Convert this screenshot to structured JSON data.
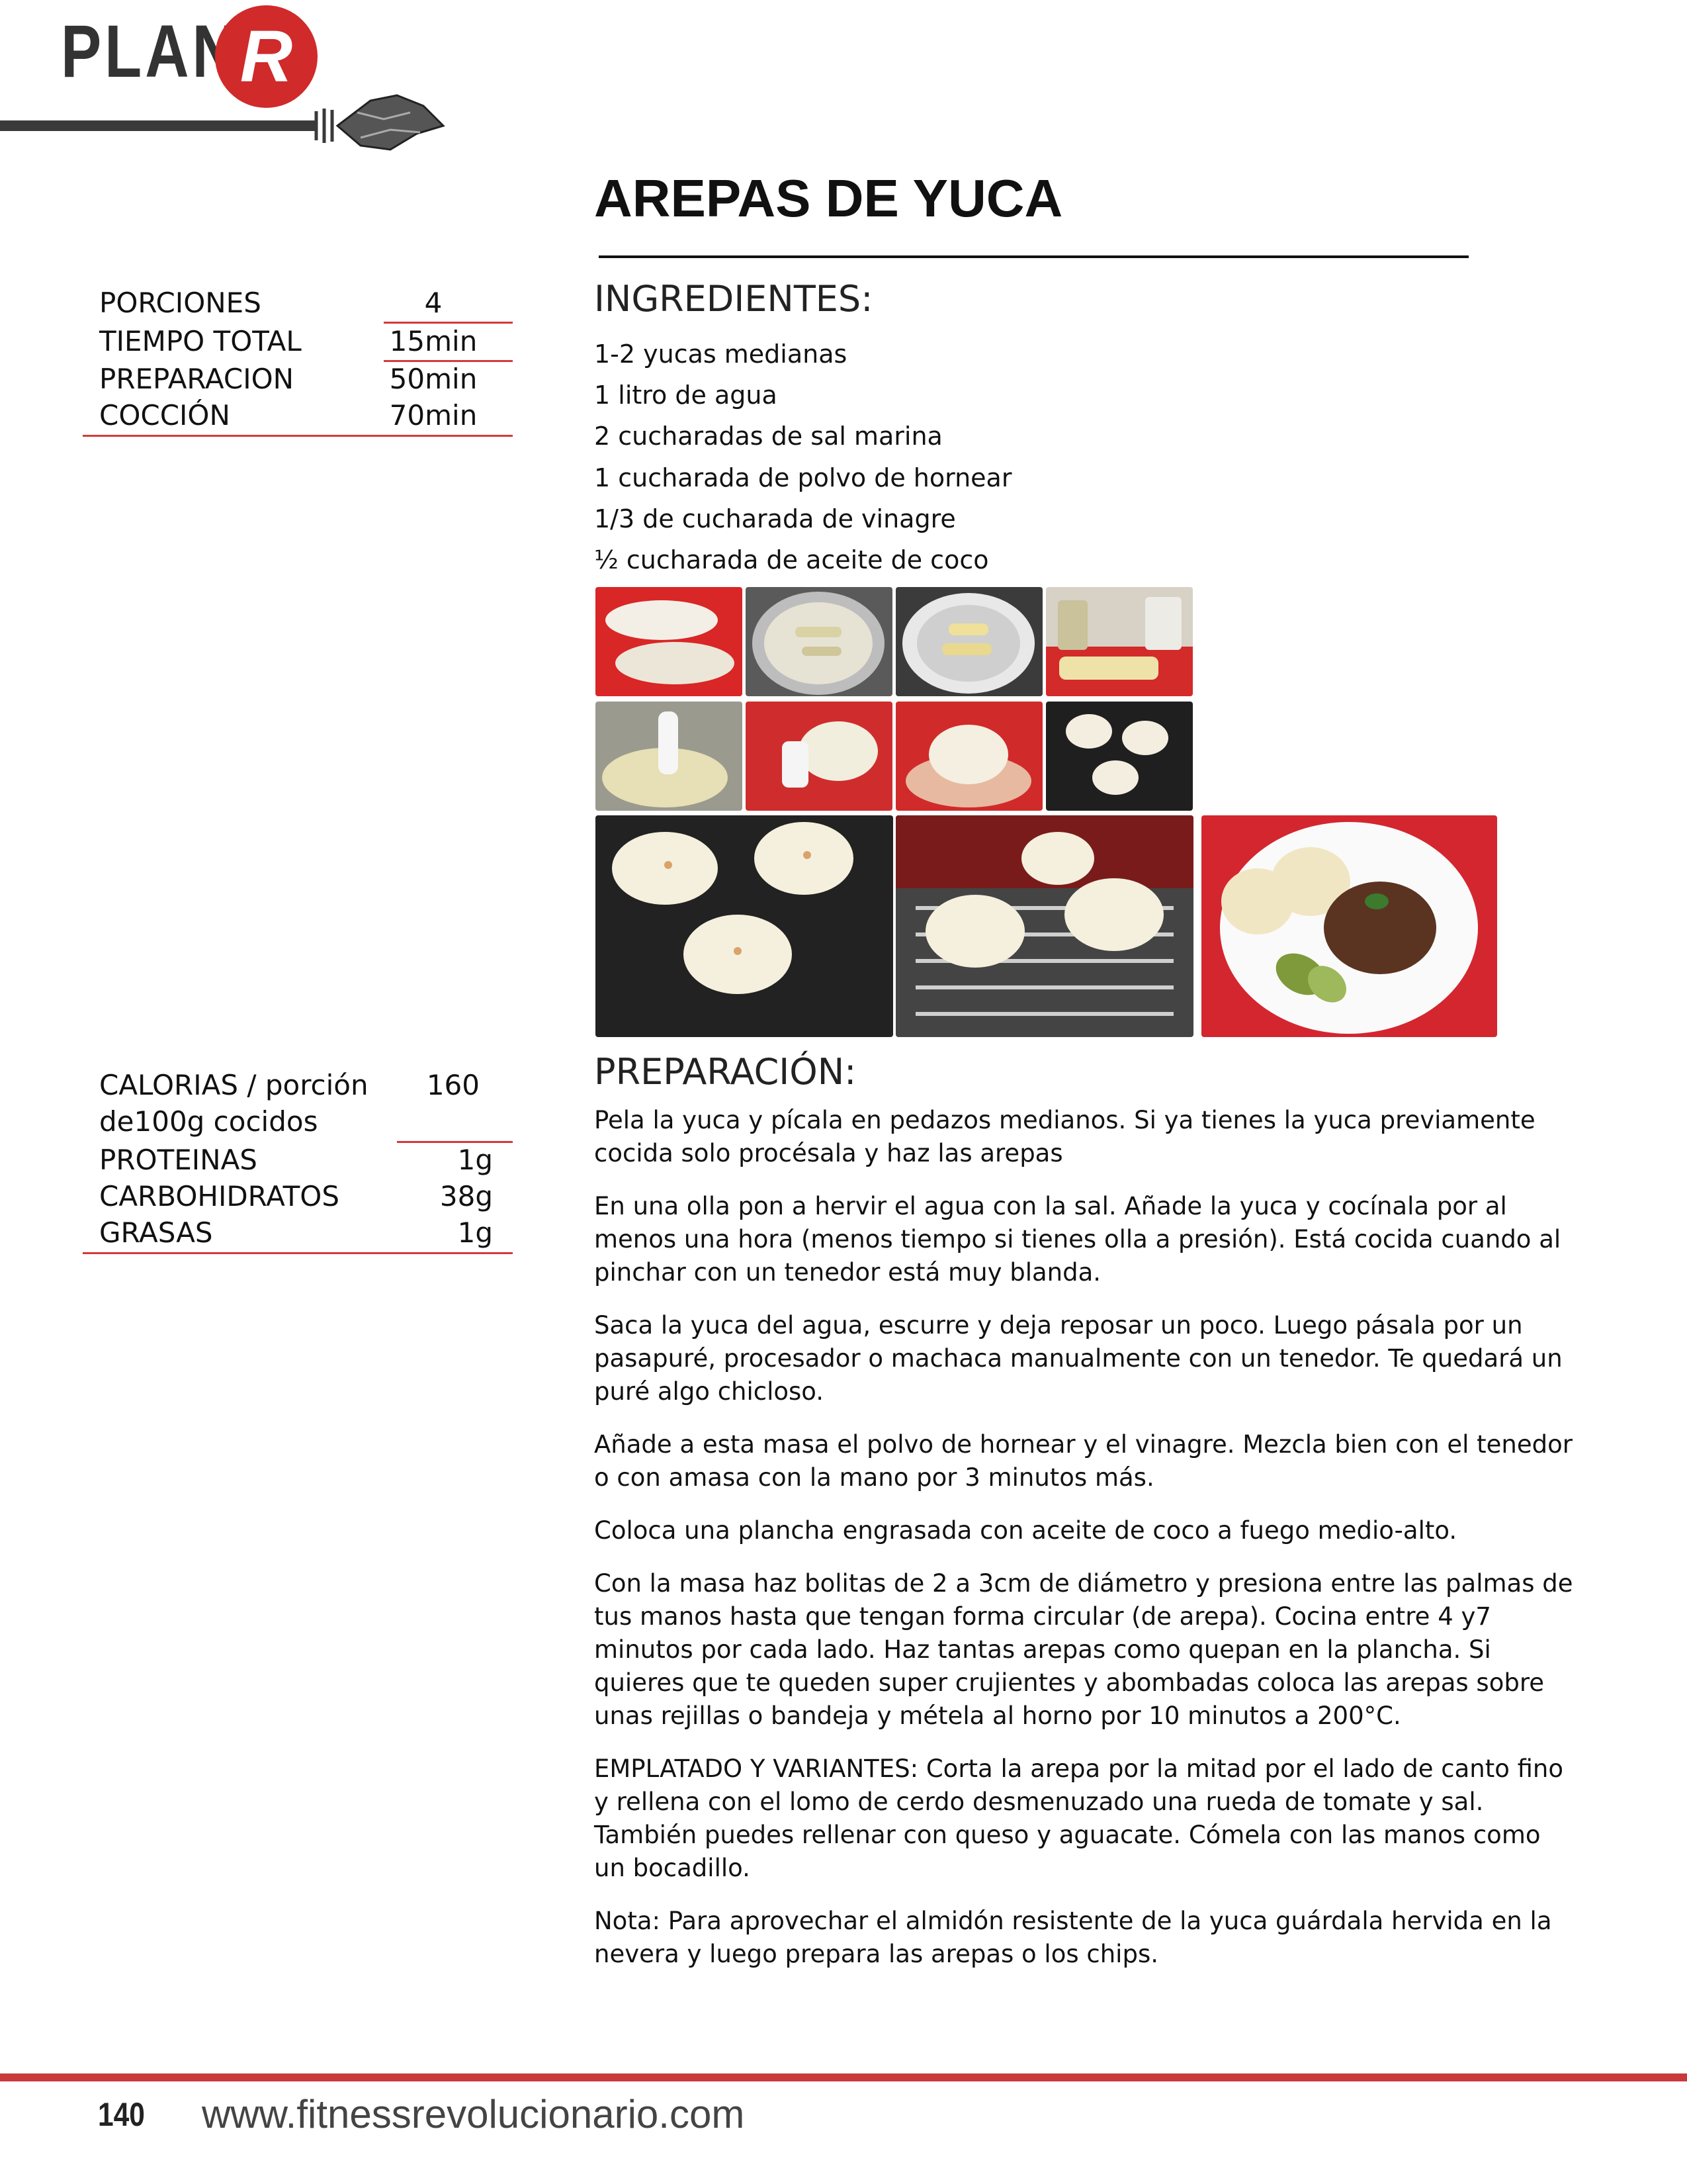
{
  "header": {
    "logo_text": "PLAN",
    "logo_letter": "R"
  },
  "title": "AREPAS DE YUCA",
  "info_table": [
    {
      "label": "PORCIONES",
      "value": "4"
    },
    {
      "label": "TIEMPO TOTAL",
      "value": "15min"
    },
    {
      "label": "PREPARACION",
      "value": "50min"
    },
    {
      "label": "COCCIÓN",
      "value": "70min"
    }
  ],
  "nutrition": {
    "calories_label": "CALORIAS / porción",
    "calories_sub": "de100g cocidos",
    "calories_value": "160",
    "rows": [
      {
        "label": "PROTEINAS",
        "value": "1g"
      },
      {
        "label": "CARBOHIDRATOS",
        "value": "38g"
      },
      {
        "label": "GRASAS",
        "value": "1g"
      }
    ]
  },
  "ingredients_heading": "INGREDIENTES:",
  "ingredients": [
    "1-2 yucas medianas",
    "1 litro de agua",
    "2 cucharadas de sal marina",
    "1 cucharada de polvo de hornear",
    "1/3 de cucharada de vinagre",
    "½ cucharada de aceite de coco"
  ],
  "preparation_heading": "PREPARACIÓN:",
  "preparation": [
    "Pela la yuca y pícala en pedazos medianos. Si ya tienes la yuca previamente cocida solo procésala y haz las arepas",
    "En una olla pon a hervir el agua con la sal. Añade la yuca y cocínala por al menos una hora (menos tiempo si tienes olla a presión). Está cocida cuando al pinchar con un tenedor está muy blanda.",
    "Saca la yuca del agua, escurre y deja reposar un poco. Luego pásala por un pasapuré, procesador o machaca manualmente con un tenedor. Te quedará un puré algo chicloso.",
    "Añade a esta masa el polvo de hornear y el vinagre. Mezcla bien con el tenedor o con amasa con la mano por 3 minutos más.",
    "Coloca una plancha engrasada con aceite de coco a fuego medio-alto.",
    "Con la masa haz bolitas de 2 a 3cm de diámetro y presiona entre las palmas de tus manos hasta que tengan forma circular (de arepa). Cocina entre 4 y7 minutos por cada lado. Haz tantas arepas como quepan en la plancha. Si quieres que te queden super crujientes  y abombadas coloca las arepas sobre unas rejillas o bandeja y métela al horno por 10 minutos a 200°C.",
    "EMPLATADO Y VARIANTES: Corta la arepa por la mitad por el lado de canto fino y rellena con el lomo de cerdo desmenuzado una rueda de tomate y sal. También puedes rellenar con queso y aguacate. Cómela con las manos como un bocadillo.",
    "Nota: Para aprovechar el almidón resistente de la yuca guárdala hervida en la nevera y luego prepara las arepas o los chips."
  ],
  "footer": {
    "page_number": "140",
    "website": "www.fitnessrevolucionario.com"
  },
  "colors": {
    "accent_red": "#d02a2a",
    "rule_red": "#d43a3a",
    "footer_red": "#c9393c"
  }
}
